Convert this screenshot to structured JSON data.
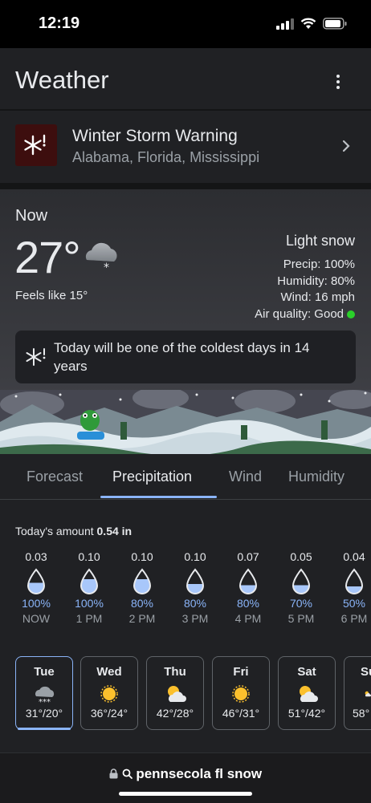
{
  "status": {
    "time": "12:19"
  },
  "header": {
    "title": "Weather"
  },
  "alert": {
    "title": "Winter Storm Warning",
    "regions": "Alabama, Florida, Mississippi",
    "color": "#3d0e0e"
  },
  "now": {
    "label": "Now",
    "temp": "27°",
    "feels_like": "Feels like 15°",
    "condition": "Light snow",
    "precip": "Precip: 100%",
    "humidity": "Humidity: 80%",
    "wind": "Wind: 16 mph",
    "air_quality": "Air quality: Good",
    "callout": "Today will be one of the coldest days in 14 years"
  },
  "tabs": [
    "Forecast",
    "Precipitation",
    "Wind",
    "Humidity"
  ],
  "precipitation": {
    "label": "Today's amount",
    "value": "0.54 in",
    "hours": [
      {
        "amount": "0.03",
        "chance": "100%",
        "time": "NOW",
        "fill": 0.45
      },
      {
        "amount": "0.10",
        "chance": "100%",
        "time": "1 PM",
        "fill": 0.6
      },
      {
        "amount": "0.10",
        "chance": "80%",
        "time": "2 PM",
        "fill": 0.6
      },
      {
        "amount": "0.10",
        "chance": "80%",
        "time": "3 PM",
        "fill": 0.4
      },
      {
        "amount": "0.07",
        "chance": "80%",
        "time": "4 PM",
        "fill": 0.35
      },
      {
        "amount": "0.05",
        "chance": "70%",
        "time": "5 PM",
        "fill": 0.35
      },
      {
        "amount": "0.04",
        "chance": "50%",
        "time": "6 PM",
        "fill": 0.3
      }
    ]
  },
  "daily": [
    {
      "day": "Tue",
      "range": "31°/20°",
      "icon": "snow-icon"
    },
    {
      "day": "Wed",
      "range": "36°/24°",
      "icon": "sun-icon"
    },
    {
      "day": "Thu",
      "range": "42°/28°",
      "icon": "partly-cloudy-icon"
    },
    {
      "day": "Fri",
      "range": "46°/31°",
      "icon": "sun-icon"
    },
    {
      "day": "Sat",
      "range": "51°/42°",
      "icon": "partly-cloudy-icon"
    },
    {
      "day": "Su",
      "range": "58°",
      "icon": "partly-cloudy-icon"
    }
  ],
  "browser": {
    "query": "pennsecola fl snow"
  },
  "colors": {
    "accent": "#8ab4f8",
    "air_good": "#2ad02a"
  }
}
